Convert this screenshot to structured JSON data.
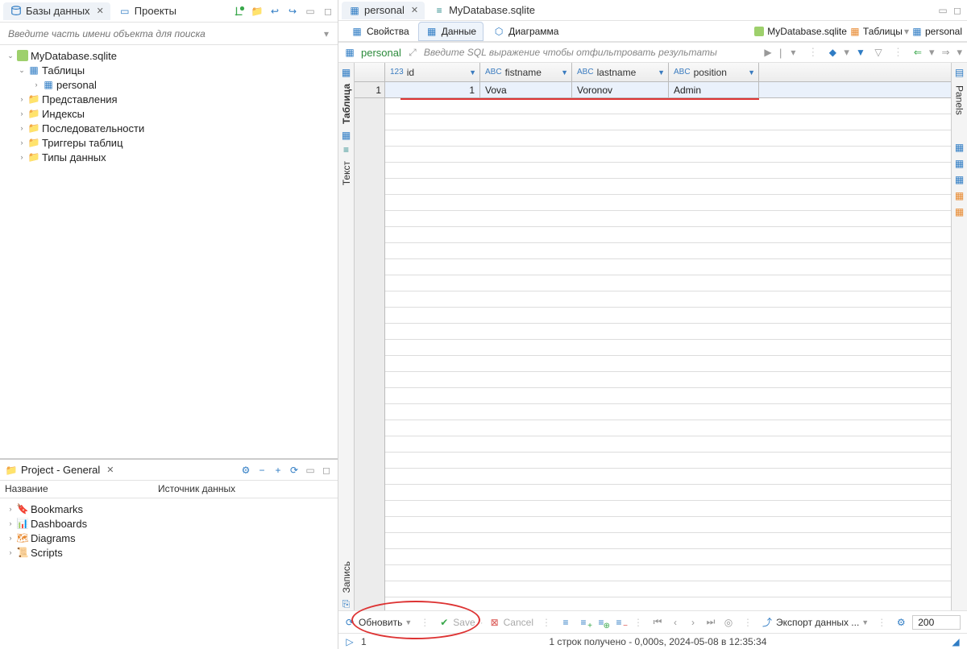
{
  "left": {
    "tabs": {
      "databases": "Базы данных",
      "projects": "Проекты"
    },
    "search_placeholder": "Введите часть имени объекта для поиска",
    "tree": {
      "root": "MyDatabase.sqlite",
      "tables": "Таблицы",
      "personal": "personal",
      "views": "Представления",
      "indexes": "Индексы",
      "sequences": "Последовательности",
      "triggers": "Триггеры таблиц",
      "types": "Типы данных"
    }
  },
  "project_panel": {
    "title": "Project - General",
    "col_name": "Название",
    "col_source": "Источник данных",
    "items": [
      "Bookmarks",
      "Dashboards",
      "Diagrams",
      "Scripts"
    ]
  },
  "editor": {
    "tab_personal": "personal",
    "tab_script": "MyDatabase.sqlite"
  },
  "breadcrumb": {
    "db": "MyDatabase.sqlite",
    "tables": "Таблицы",
    "table": "personal"
  },
  "subtabs": {
    "props": "Свойства",
    "data": "Данные",
    "diagram": "Диаграмма"
  },
  "filter": {
    "table": "personal",
    "placeholder": "Введите SQL выражение чтобы отфильтровать результаты"
  },
  "sidetabs": {
    "table": "Таблица",
    "text": "Текст",
    "record": "Запись",
    "panels": "Panels"
  },
  "grid": {
    "cols": {
      "id": "id",
      "firstname": "fistname",
      "lastname": "lastname",
      "position": "position"
    },
    "row": {
      "num": "1",
      "id": "1",
      "firstname": "Vova",
      "lastname": "Voronov",
      "position": "Admin"
    }
  },
  "bottom": {
    "refresh": "Обновить",
    "save": "Save",
    "cancel": "Cancel",
    "export": "Экспорт данных ...",
    "page_size": "200",
    "rownum": "1"
  },
  "status": {
    "msg": "1 строк получено - 0,000s, 2024-05-08 в 12:35:34"
  }
}
